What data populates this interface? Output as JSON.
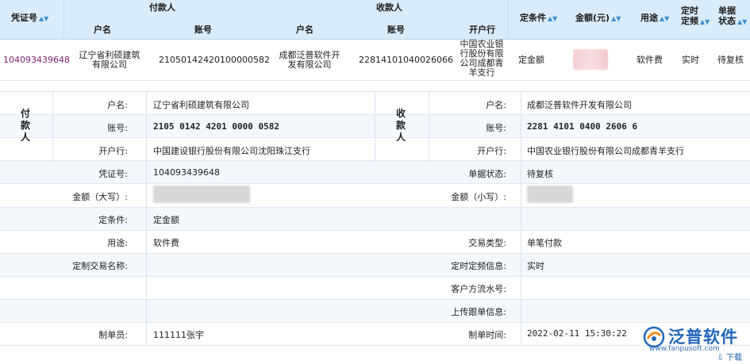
{
  "grid": {
    "headers": {
      "voucher_no": "凭证号",
      "payer_group": "付款人",
      "payee_group": "收款人",
      "payer_name": "户名",
      "payer_account": "账号",
      "payee_name": "户名",
      "payee_account": "账号",
      "payee_bank": "开户行",
      "condition": "定条件",
      "amount": "金额(元)",
      "purpose": "用途",
      "timing_l1": "定时",
      "timing_l2": "定频",
      "status_l1": "单据",
      "status_l2": "状态"
    },
    "row": {
      "voucher_no": "104093439648",
      "payer_name_l1": "辽宁省利硕建筑",
      "payer_name_l2": "有限公司",
      "payer_account": "21050142420100000582",
      "payee_name_l1": "成都泛普软件开",
      "payee_name_l2": "发有限公司",
      "payee_account": "22814101040026066",
      "payee_bank_l1": "中国农业银",
      "payee_bank_l2": "行股份有限",
      "payee_bank_l3": "公司成都青",
      "payee_bank_l4": "羊支行",
      "condition": "定金额",
      "purpose": "软件费",
      "timing": "实时",
      "status": "待复核"
    }
  },
  "detail": {
    "payer_label": "付款人",
    "payee_label": "收款人",
    "labels": {
      "account_name": "户名:",
      "account_no": "账号:",
      "bank": "开户行:",
      "voucher_no": "凭证号:",
      "status": "单据状态:",
      "amount_upper": "金额（大写）:",
      "amount_lower": "金额（小写）:",
      "condition": "定条件:",
      "purpose": "用途:",
      "trade_type": "交易类型:",
      "custom_trade_name": "定制交易名称:",
      "timing_info": "定时定频信息:",
      "customer_serial": "客户方流水号:",
      "upload_info": "上传跟单信息:",
      "maker": "制单员:",
      "make_time": "制单时间:"
    },
    "payer": {
      "account_name": "辽宁省利硕建筑有限公司",
      "account_no": "2105 0142 4201 0000 0582",
      "bank": "中国建设银行股份有限公司沈阳珠江支行"
    },
    "payee": {
      "account_name": "成都泛普软件开发有限公司",
      "account_no": "2281 4101 0400 2606 6",
      "bank": "中国农业银行股份有限公司成都青羊支行"
    },
    "voucher_no": "104093439648",
    "status": "待复核",
    "condition": "定金额",
    "purpose": "软件费",
    "trade_type": "单笔付款",
    "custom_trade_name": "",
    "timing_info": "实时",
    "customer_serial": "",
    "upload_info": "",
    "maker": "111111张宇",
    "make_time": "2022-02-11 15:30:22"
  },
  "footer": {
    "logo_text": "泛普软件",
    "logo_url": "www.fanpusoft.com",
    "download_label": "下载"
  }
}
